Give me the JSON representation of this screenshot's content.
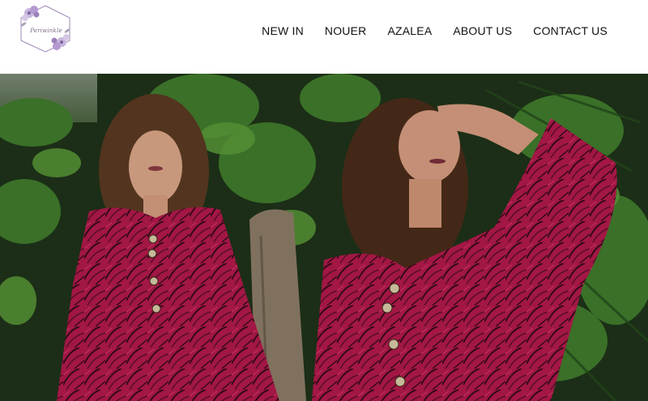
{
  "brand": {
    "logo_text": "Periwinkle",
    "logo_icon": "floral-frame-logo"
  },
  "nav": {
    "items": [
      {
        "label": "NEW IN"
      },
      {
        "label": "NOUER"
      },
      {
        "label": "AZALEA"
      },
      {
        "label": "ABOUT US"
      },
      {
        "label": "CONTACT US"
      }
    ]
  },
  "hero": {
    "image": "two-models-in-magenta-printed-kurtas-garden-backdrop"
  },
  "colors": {
    "nav_text": "#111111",
    "header_bg": "#ffffff",
    "garment": "#b0194a",
    "foliage": "#2f5a22",
    "logo_purple": "#a48bc0"
  }
}
